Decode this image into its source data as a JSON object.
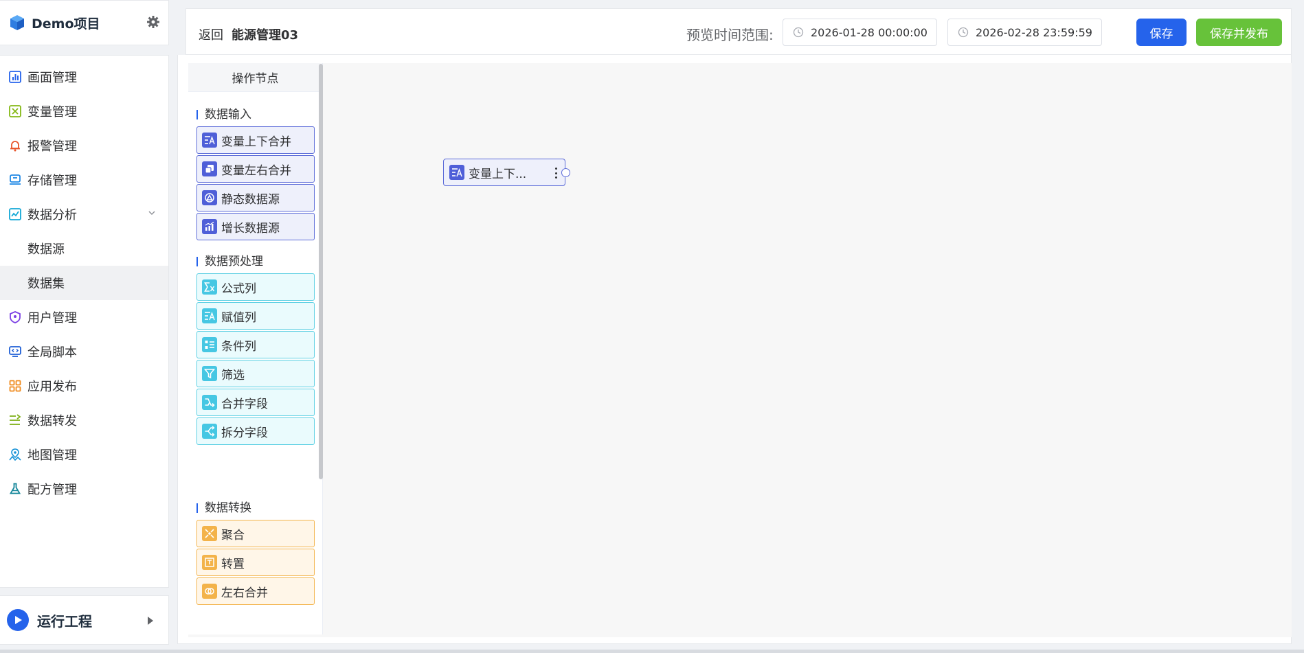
{
  "sidebar": {
    "project_title": "Demo项目",
    "items": [
      {
        "label": "画面管理",
        "icon": "bar-chart-icon"
      },
      {
        "label": "变量管理",
        "icon": "variable-icon"
      },
      {
        "label": "报警管理",
        "icon": "bell-icon"
      },
      {
        "label": "存储管理",
        "icon": "storage-icon"
      },
      {
        "label": "数据分析",
        "icon": "line-chart-icon"
      },
      {
        "label": "数据源"
      },
      {
        "label": "数据集"
      },
      {
        "label": "用户管理",
        "icon": "shield-user-icon"
      },
      {
        "label": "全局脚本",
        "icon": "code-monitor-icon"
      },
      {
        "label": "应用发布",
        "icon": "grid-apps-icon"
      },
      {
        "label": "数据转发",
        "icon": "forward-icon"
      },
      {
        "label": "地图管理",
        "icon": "map-icon"
      },
      {
        "label": "配方管理",
        "icon": "flask-icon"
      }
    ],
    "run_label": "运行工程"
  },
  "header": {
    "back": "返回",
    "name": "能源管理03",
    "range_label": "预览时间范围:",
    "start": "2026-01-28 00:00:00",
    "end": "2026-02-28 23:59:59",
    "save": "保存",
    "publish": "保存并发布"
  },
  "panel": {
    "title": "操作节点",
    "groups": [
      {
        "title": "数据输入",
        "nodes": [
          "变量上下合并",
          "变量左右合并",
          "静态数据源",
          "增长数据源"
        ]
      },
      {
        "title": "数据预处理",
        "nodes": [
          "公式列",
          "赋值列",
          "条件列",
          "筛选",
          "合并字段",
          "拆分字段"
        ]
      },
      {
        "title": "数据转换",
        "nodes": [
          "聚合",
          "转置",
          "左右合并"
        ]
      }
    ]
  },
  "canvas": {
    "node_label": "变量上下..."
  },
  "colors": {
    "primary": "#2563eb",
    "success": "#67c23a",
    "node_blue": "#4f5fd8",
    "node_cyan": "#46c7e3",
    "node_orange": "#f3b34a"
  }
}
